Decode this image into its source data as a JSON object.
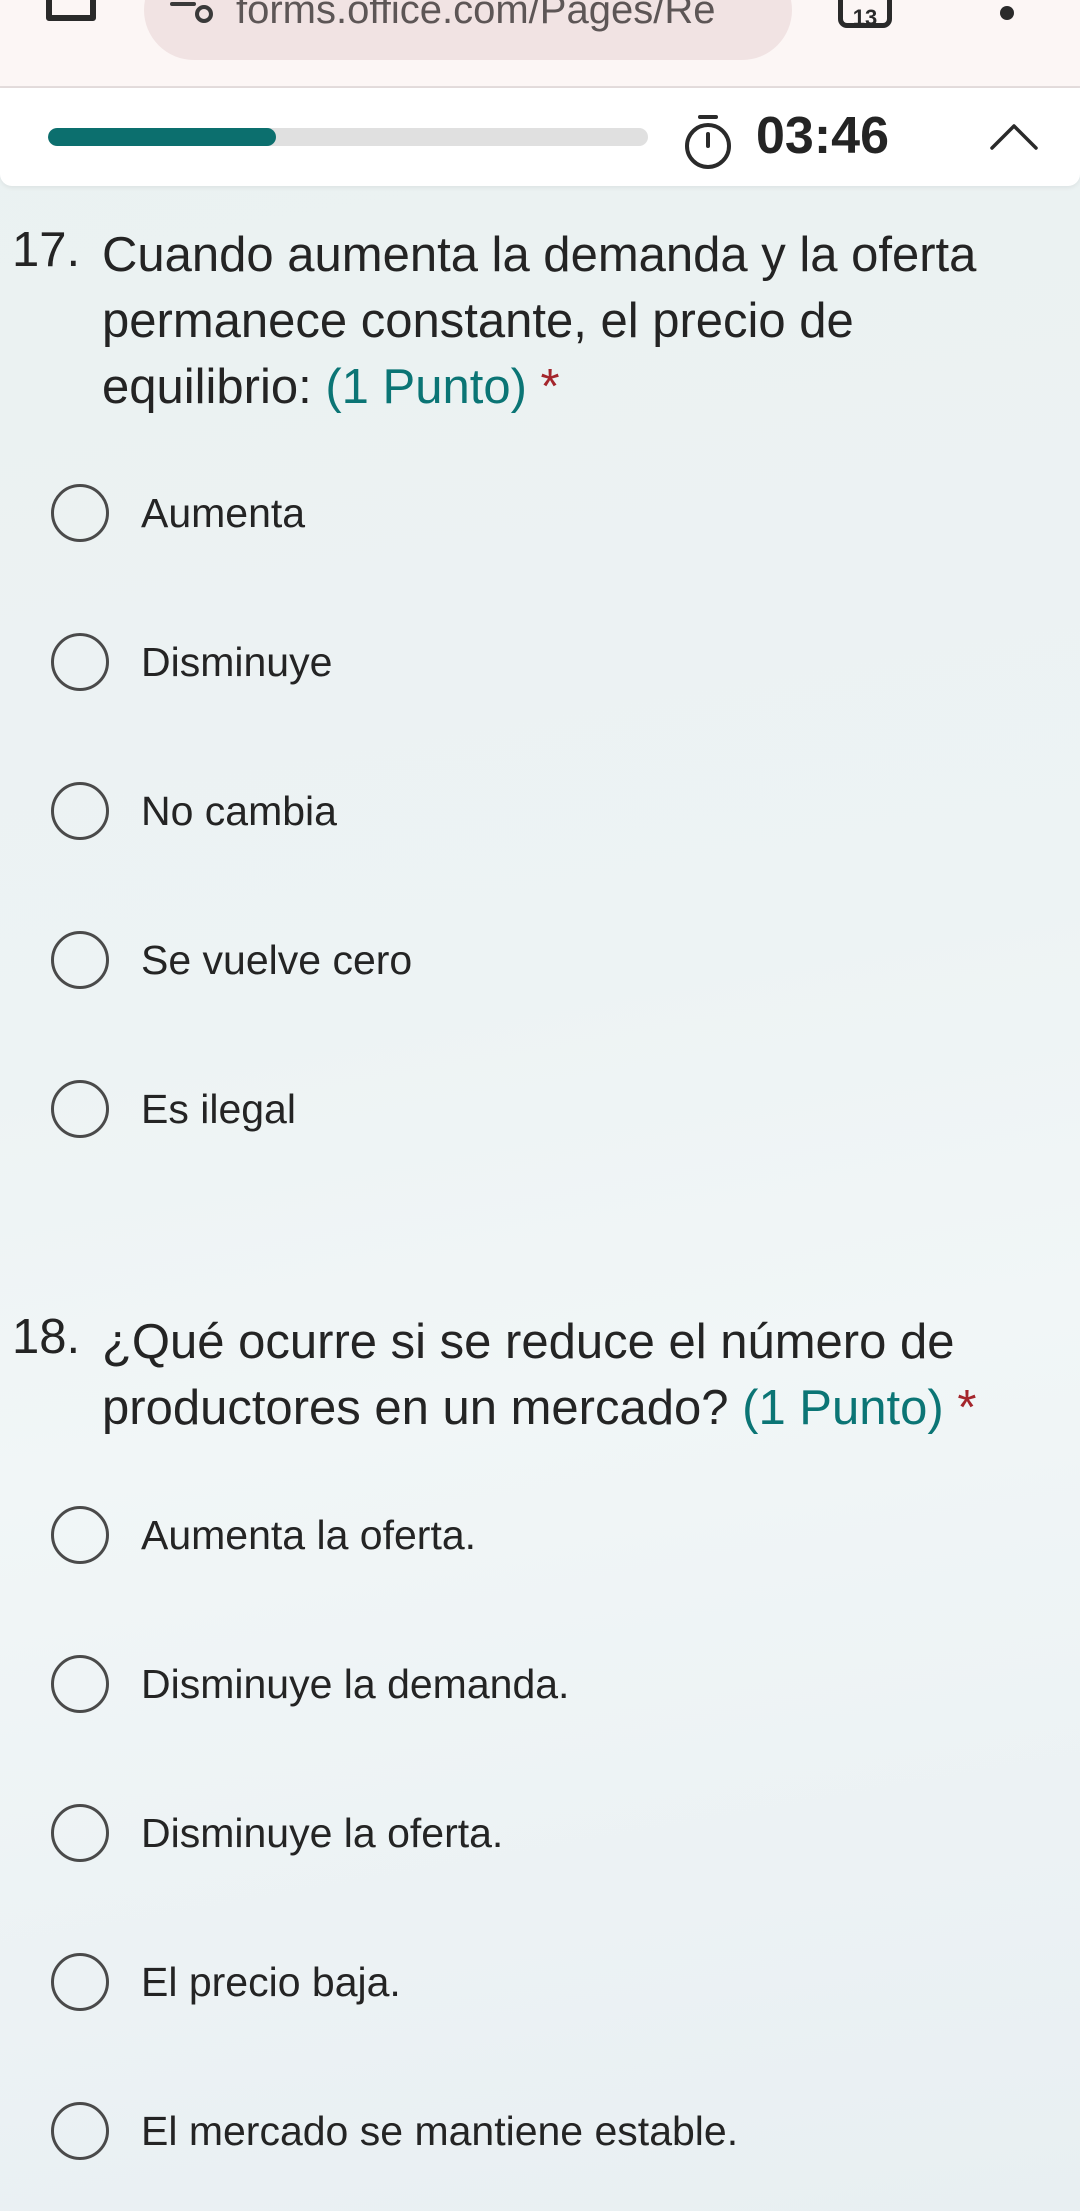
{
  "browser": {
    "url": "forms.office.com/Pages/Re",
    "tab_count": "13"
  },
  "timer": {
    "time": "03:46",
    "progress": 0.38
  },
  "questions": [
    {
      "number": "17.",
      "text": "Cuando aumenta la demanda y la oferta permanece constante, el precio de equilibrio: ",
      "points": "(1 Punto)",
      "required": "*",
      "options": [
        "Aumenta",
        "Disminuye",
        "No cambia",
        "Se vuelve cero",
        "Es ilegal"
      ]
    },
    {
      "number": "18.",
      "text": "¿Qué ocurre si se reduce el número de productores en un mercado? ",
      "points": "(1 Punto)",
      "required": "*",
      "options": [
        "Aumenta la oferta.",
        "Disminuye la demanda.",
        "Disminuye la oferta.",
        "El precio baja.",
        "El mercado se mantiene estable."
      ]
    }
  ],
  "colors": {
    "accent": "#0c6f6e",
    "points": "#0b7575",
    "required": "#a4262c"
  }
}
